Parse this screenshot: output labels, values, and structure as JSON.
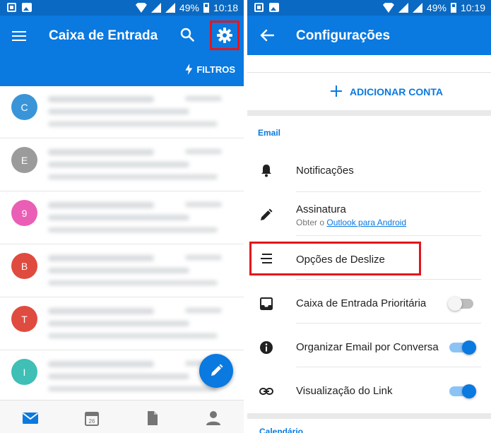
{
  "left": {
    "status": {
      "battery": "49%",
      "time": "10:18"
    },
    "header": {
      "title": "Caixa de Entrada",
      "filter_label": "FILTROS"
    },
    "messages": [
      {
        "initial": "C",
        "color": "#3a95d8"
      },
      {
        "initial": "E",
        "color": "#9b9b9b"
      },
      {
        "initial": "9",
        "color": "#ea5fb5"
      },
      {
        "initial": "B",
        "color": "#e04b3f"
      },
      {
        "initial": "T",
        "color": "#e04b3f"
      },
      {
        "initial": "I",
        "color": "#3fbfb5"
      }
    ],
    "bottom_nav": [
      "mail-icon",
      "calendar-icon",
      "files-icon",
      "people-icon"
    ],
    "calendar_day": "26"
  },
  "right": {
    "status": {
      "battery": "49%",
      "time": "10:19"
    },
    "header": {
      "title": "Configurações"
    },
    "add_account_label": "ADICIONAR CONTA",
    "section_label": "Email",
    "rows": [
      {
        "label": "Notificações",
        "icon": "bell-icon"
      },
      {
        "label": "Assinatura",
        "sub_prefix": "Obter o ",
        "sub_link": "Outlook para Android",
        "icon": "pencil-icon"
      },
      {
        "label": "Opções de Deslize",
        "icon": "swipe-lines-icon"
      },
      {
        "label": "Caixa de Entrada Prioritária",
        "icon": "inbox-icon",
        "toggle": false
      },
      {
        "label": "Organizar Email por Conversa",
        "icon": "info-icon",
        "toggle": true
      },
      {
        "label": "Visualização do Link",
        "icon": "link-icon",
        "toggle": true
      }
    ],
    "next_section_label_partial": "Calendário"
  },
  "colors": {
    "brand": "#0a79e0",
    "highlight": "#e3161c"
  }
}
